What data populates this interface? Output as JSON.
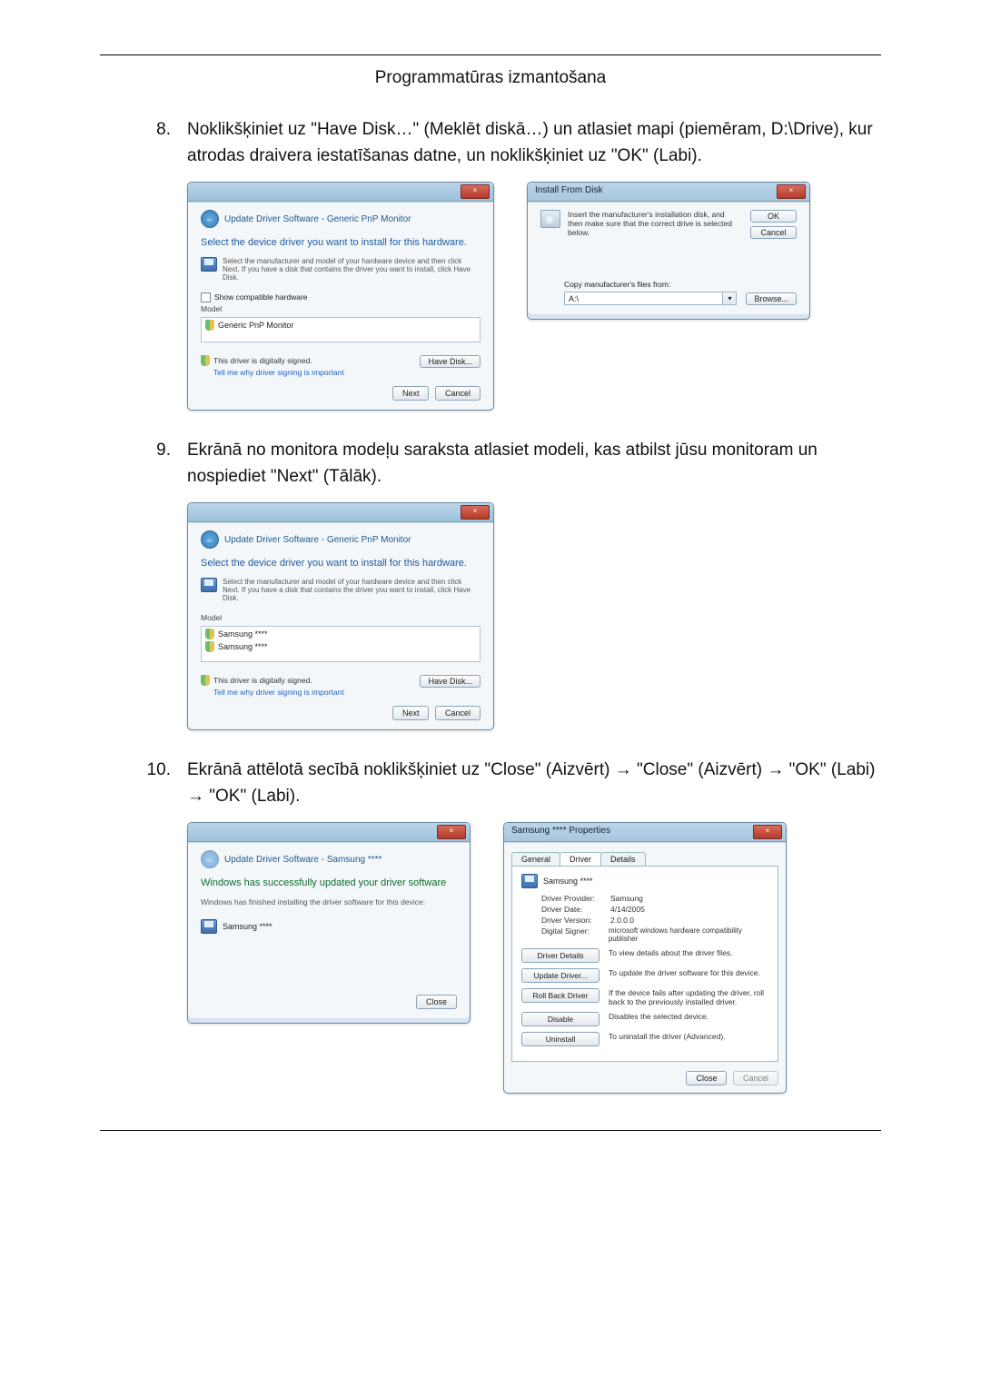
{
  "header": "Programmatūras izmantošana",
  "steps": {
    "s8": {
      "num": "8.",
      "text": "Noklikšķiniet uz \"Have Disk…\" (Meklēt diskā…) un atlasiet mapi (piemēram, D:\\Drive), kur atrodas draivera iestatīšanas datne, un noklikšķiniet uz \"OK\" (Labi)."
    },
    "s9": {
      "num": "9.",
      "text": "Ekrānā no monitora modeļu saraksta atlasiet modeli, kas atbilst jūsu monitoram un nospiediet \"Next\" (Tālāk)."
    },
    "s10": {
      "num": "10.",
      "text": "Ekrānā attēlotā secībā noklikšķiniet uz \"Close\" (Aizvērt) → \"Close\" (Aizvērt) → \"OK\" (Labi) → \"OK\" (Labi)."
    }
  },
  "win1": {
    "nav": "Update Driver Software - Generic PnP Monitor",
    "headline": "Select the device driver you want to install for this hardware.",
    "sub": "Select the manufacturer and model of your hardware device and then click Next. If you have a disk that contains the driver you want to install, click Have Disk.",
    "compat": "Show compatible hardware",
    "colModel": "Model",
    "model1": "Generic PnP Monitor",
    "signed": "This driver is digitally signed.",
    "tell": "Tell me why driver signing is important",
    "havedisk": "Have Disk...",
    "next": "Next",
    "cancel": "Cancel",
    "close": "×"
  },
  "win2": {
    "title": "Install From Disk",
    "msg": "Insert the manufacturer's installation disk, and then make sure that the correct drive is selected below.",
    "ok": "OK",
    "cancel": "Cancel",
    "copy": "Copy manufacturer's files from:",
    "path": "A:\\",
    "browse": "Browse...",
    "close": "×",
    "arrow": "▾"
  },
  "win3": {
    "nav": "Update Driver Software - Generic PnP Monitor",
    "headline": "Select the device driver you want to install for this hardware.",
    "sub": "Select the manufacturer and model of your hardware device and then click Next. If you have a disk that contains the driver you want to install, click Have Disk.",
    "colModel": "Model",
    "m1": "Samsung ****",
    "m2": "Samsung ****",
    "signed": "This driver is digitally signed.",
    "tell": "Tell me why driver signing is important",
    "havedisk": "Have Disk...",
    "next": "Next",
    "cancel": "Cancel",
    "close": "×"
  },
  "win4": {
    "nav": "Update Driver Software - Samsung ****",
    "headline": "Windows has successfully updated your driver software",
    "sub": "Windows has finished installing the driver software for this device:",
    "device": "Samsung ****",
    "closeBtn": "Close",
    "close": "×"
  },
  "win5": {
    "title": "Samsung **** Properties",
    "tabs": {
      "general": "General",
      "driver": "Driver",
      "details": "Details"
    },
    "device": "Samsung ****",
    "provider": {
      "k": "Driver Provider:",
      "v": "Samsung"
    },
    "date": {
      "k": "Driver Date:",
      "v": "4/14/2005"
    },
    "version": {
      "k": "Driver Version:",
      "v": "2.0.0.0"
    },
    "signer": {
      "k": "Digital Signer:",
      "v": "microsoft windows hardware compatibility publisher"
    },
    "b1": {
      "l": "Driver Details",
      "d": "To view details about the driver files."
    },
    "b2": {
      "l": "Update Driver...",
      "d": "To update the driver software for this device."
    },
    "b3": {
      "l": "Roll Back Driver",
      "d": "If the device fails after updating the driver, roll back to the previously installed driver."
    },
    "b4": {
      "l": "Disable",
      "d": "Disables the selected device."
    },
    "b5": {
      "l": "Uninstall",
      "d": "To uninstall the driver (Advanced)."
    },
    "closeBtn": "Close",
    "cancel": "Cancel",
    "close": "×"
  }
}
